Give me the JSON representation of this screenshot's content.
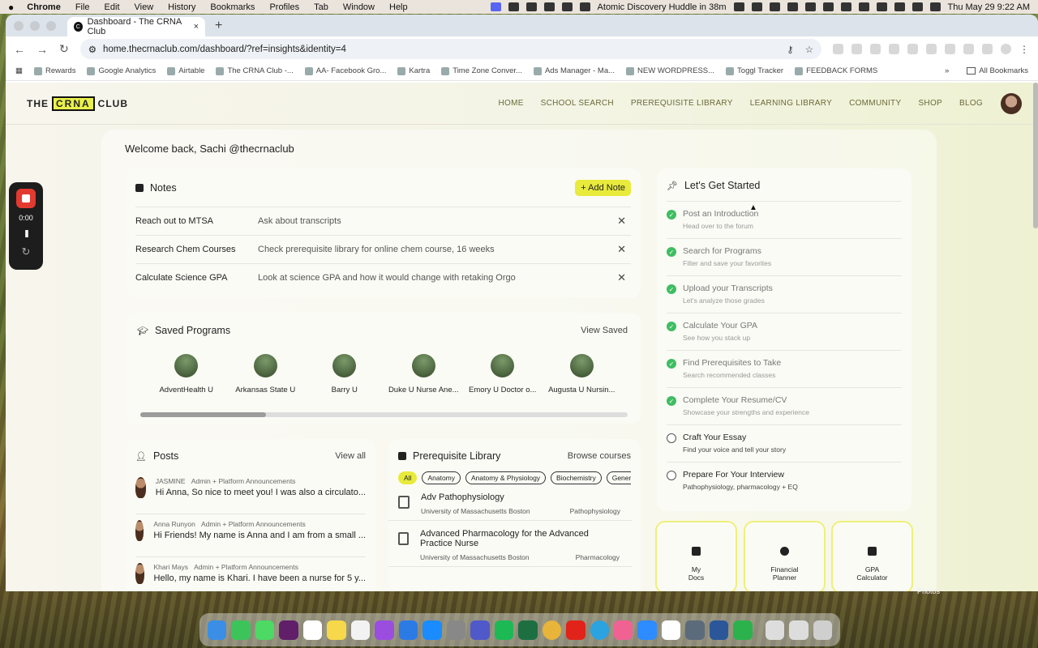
{
  "menubar": {
    "app": "Chrome",
    "items": [
      "File",
      "Edit",
      "View",
      "History",
      "Bookmarks",
      "Profiles",
      "Tab",
      "Window",
      "Help"
    ],
    "event": "Atomic Discovery Huddle in 38m",
    "datetime": "Thu May 29  9:22 AM"
  },
  "browser": {
    "tab_title": "Dashboard - The CRNA Club",
    "url": "home.thecrnaclub.com/dashboard/?ref=insights&identity=4",
    "new_tab": "+",
    "close": "×"
  },
  "bookmarks": [
    "Rewards",
    "Google Analytics",
    "Airtable",
    "The CRNA Club -...",
    "AA- Facebook Gro...",
    "Kartra",
    "Time Zone Conver...",
    "Ads Manager - Ma...",
    "NEW WORDPRESS...",
    "Toggl Tracker",
    "FEEDBACK FORMS"
  ],
  "all_bookmarks": "All Bookmarks",
  "site": {
    "logo_left": "THE",
    "logo_box": "CRNA",
    "logo_right": "CLUB",
    "nav": [
      "HOME",
      "SCHOOL SEARCH",
      "PREREQUISITE LIBRARY",
      "LEARNING LIBRARY",
      "COMMUNITY",
      "SHOP",
      "BLOG"
    ]
  },
  "welcome": "Welcome back, Sachi @thecrnaclub",
  "notes": {
    "title": "Notes",
    "add_label": "+ Add Note",
    "items": [
      {
        "title": "Reach out to MTSA",
        "desc": "Ask about transcripts"
      },
      {
        "title": "Research Chem Courses",
        "desc": "Check prerequisite library for online chem course, 16 weeks"
      },
      {
        "title": "Calculate Science GPA",
        "desc": "Look at science GPA and how it would change with retaking Orgo"
      }
    ]
  },
  "saved": {
    "title": "Saved Programs",
    "link": "View Saved",
    "programs": [
      "AdventHealth U",
      "Arkansas State U",
      "Barry U",
      "Duke U Nurse Ane...",
      "Emory U Doctor o...",
      "Augusta U Nursin..."
    ]
  },
  "posts": {
    "title": "Posts",
    "link": "View all",
    "items": [
      {
        "author": "JASMINE",
        "category": "Admin + Platform Announcements",
        "text": "Hi Anna, So nice to meet you! I was also a circulato..."
      },
      {
        "author": "Anna Runyon",
        "category": "Admin + Platform Announcements",
        "text": "Hi Friends! My name is Anna and I am from a small ..."
      },
      {
        "author": "Khari Mays",
        "category": "Admin + Platform Announcements",
        "text": "Hello, my name is Khari. I have been a nurse for 5 y..."
      }
    ]
  },
  "prereq": {
    "title": "Prerequisite Library",
    "link": "Browse courses",
    "chips": [
      "All",
      "Anatomy",
      "Anatomy & Physiology",
      "Biochemistry",
      "Gener"
    ],
    "courses": [
      {
        "name": "Adv Pathophysiology",
        "school": "University of Massachusetts Boston",
        "subject": "Pathophysiology"
      },
      {
        "name": "Advanced Pharmacology for the Advanced Practice Nurse",
        "school": "University of Massachusetts Boston",
        "subject": "Pharmacology"
      }
    ]
  },
  "started": {
    "title": "Let's Get Started",
    "steps": [
      {
        "title": "Post an Introduction",
        "desc": "Head over to the forum",
        "done": true
      },
      {
        "title": "Search for Programs",
        "desc": "Filter and save your favorites",
        "done": true
      },
      {
        "title": "Upload your Transcripts",
        "desc": "Let's analyze those grades",
        "done": true
      },
      {
        "title": "Calculate Your GPA",
        "desc": "See how you stack up",
        "done": true
      },
      {
        "title": "Find Prerequisites to Take",
        "desc": "Search recommended classes",
        "done": true
      },
      {
        "title": "Complete Your Resume/CV",
        "desc": "Showcase your strengths and experience",
        "done": true
      },
      {
        "title": "Craft Your Essay",
        "desc": "Find your voice and tell your story",
        "done": false
      },
      {
        "title": "Prepare For Your Interview",
        "desc": "Pathophysiology, pharmacology + EQ",
        "done": false
      }
    ]
  },
  "tools": [
    {
      "l1": "My",
      "l2": "Docs"
    },
    {
      "l1": "Financial",
      "l2": "Planner"
    },
    {
      "l1": "GPA",
      "l2": "Calculator"
    }
  ],
  "recorder": {
    "time": "0:00",
    "pause": "II",
    "reset": "↻"
  },
  "desktop_label": "Photos",
  "colors": {
    "accent": "#e8ea3c",
    "check": "#3fbd62",
    "record": "#e23a30"
  }
}
